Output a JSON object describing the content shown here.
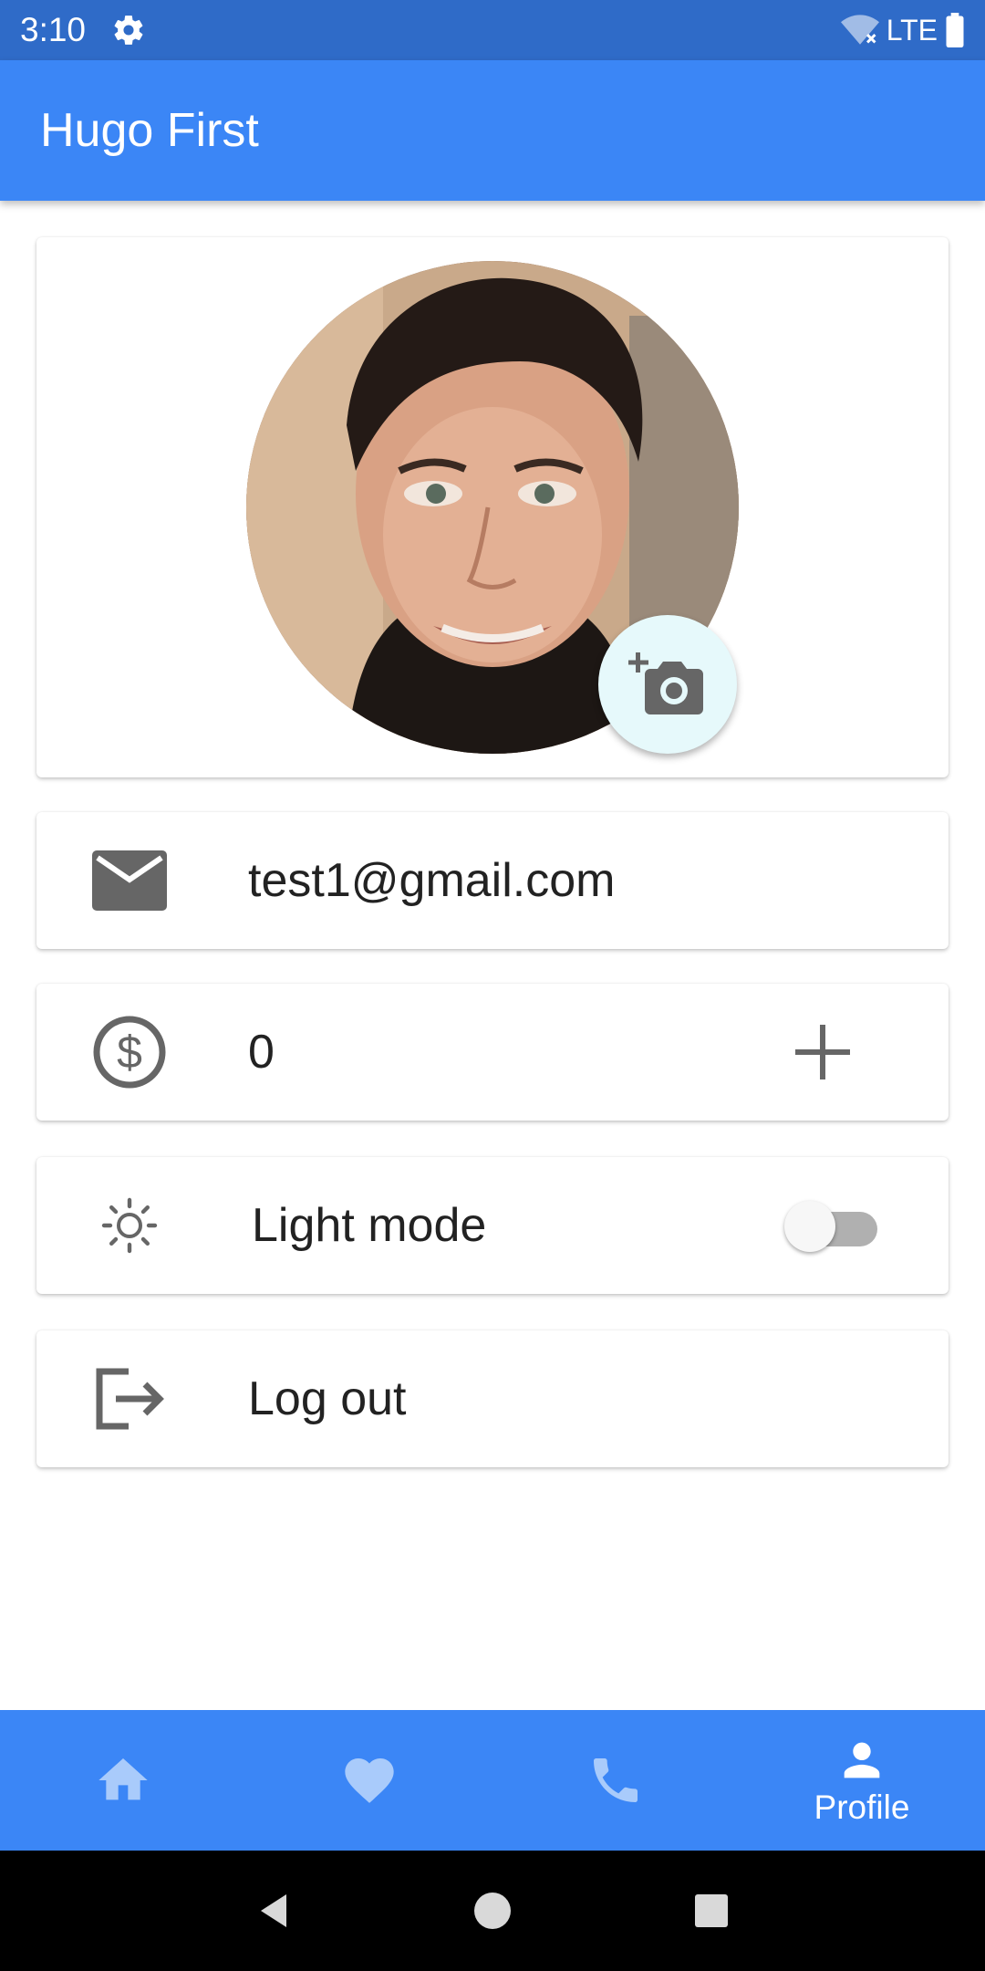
{
  "status_bar": {
    "time": "3:10",
    "network": "LTE",
    "icons": [
      "gear-icon",
      "wifi-off-icon",
      "battery-icon"
    ]
  },
  "app_bar": {
    "title": "Hugo First"
  },
  "profile": {
    "avatar_icon": "avatar",
    "camera_icon": "add-photo-icon",
    "email": "test1@gmail.com",
    "balance": "0",
    "mode_label": "Light mode",
    "dark_mode_enabled": false,
    "logout_label": "Log out"
  },
  "bottom_nav": {
    "items": [
      {
        "icon": "home-icon",
        "label": ""
      },
      {
        "icon": "heart-icon",
        "label": ""
      },
      {
        "icon": "phone-icon",
        "label": ""
      },
      {
        "icon": "person-icon",
        "label": "Profile"
      }
    ],
    "active_index": 3
  },
  "colors": {
    "primary": "#3b86f6",
    "status_bar": "#2f6bc8",
    "nav_inactive": "#a9cbfb",
    "icon_gray": "#666666",
    "camera_bg": "#e6f9fb"
  }
}
